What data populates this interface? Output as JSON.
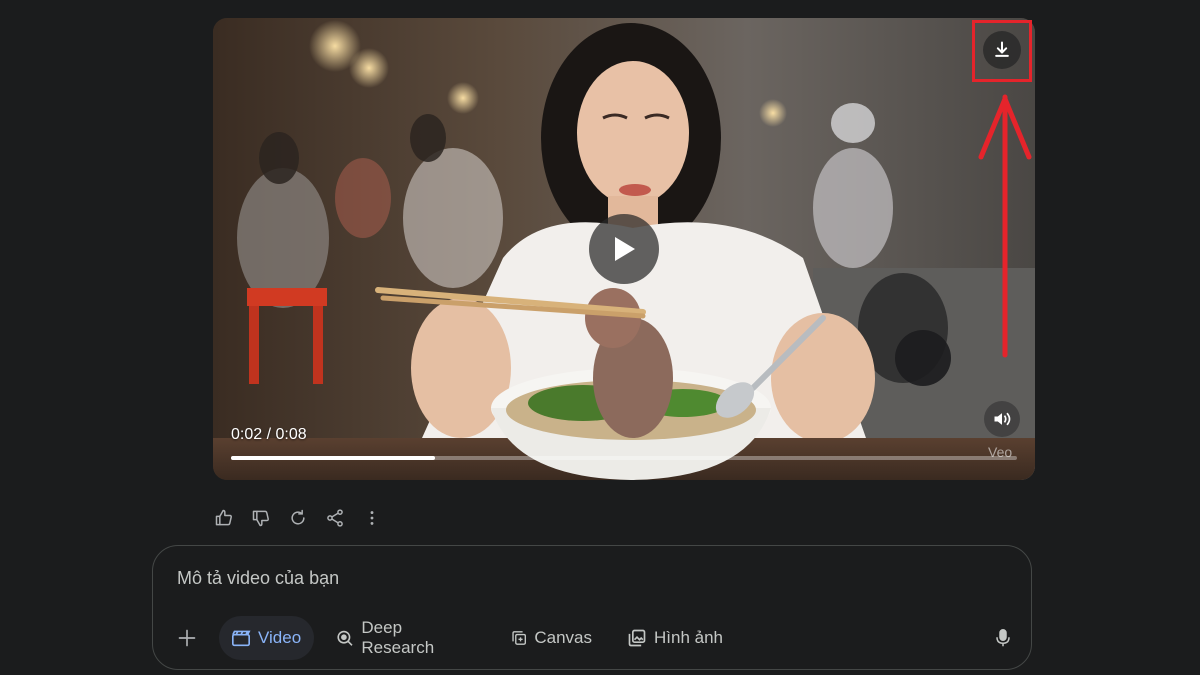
{
  "player": {
    "time_readout": "0:02 / 0:08",
    "progress": 0.26,
    "watermark": "Veo"
  },
  "composer": {
    "placeholder": "Mô tả video của bạn",
    "tools": [
      {
        "label": "Video",
        "icon": "video-clapper-icon",
        "active": true
      },
      {
        "label": "Deep Research",
        "icon": "deep-research-icon",
        "active": false
      },
      {
        "label": "Canvas",
        "icon": "canvas-icon",
        "active": false
      },
      {
        "label": "Hình ảnh",
        "icon": "image-icon",
        "active": false
      }
    ]
  },
  "colors": {
    "background": "#1b1c1d",
    "accent_blue": "#8ab4f8",
    "annotation_red": "#e5242b"
  }
}
